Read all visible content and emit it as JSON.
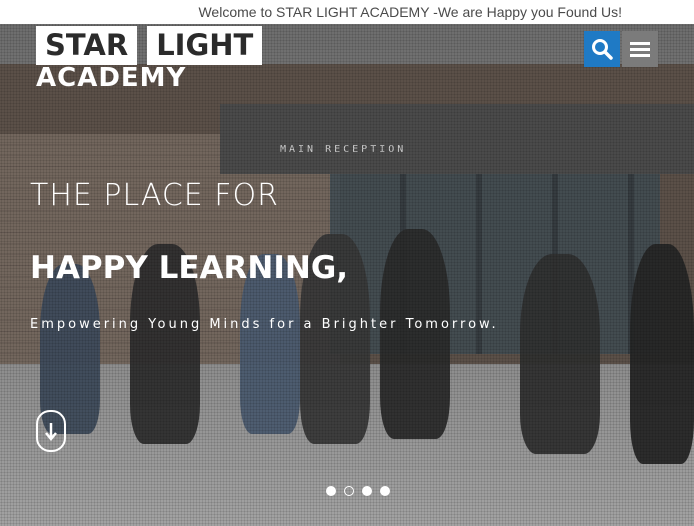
{
  "topbar": {
    "welcome": "Welcome to STAR LIGHT ACADEMY -We are Happy you Found Us!"
  },
  "logo": {
    "word1": "STAR",
    "word2": "LIGHT",
    "sub": "ACADEMY"
  },
  "hero": {
    "headline_line1": "THE PLACE FOR",
    "headline_line2": "HAPPY LEARNING,",
    "tagline": "Empowering Young Minds for a Brighter Tomorrow.",
    "sign_text": "MAIN RECEPTION"
  },
  "icons": {
    "search": "search-icon",
    "menu": "hamburger-icon",
    "scroll": "arrow-down-icon"
  },
  "slider": {
    "count": 4,
    "active": 2
  },
  "colors": {
    "accent": "#1f7ac5",
    "menu_bg": "#7b7b7b"
  }
}
